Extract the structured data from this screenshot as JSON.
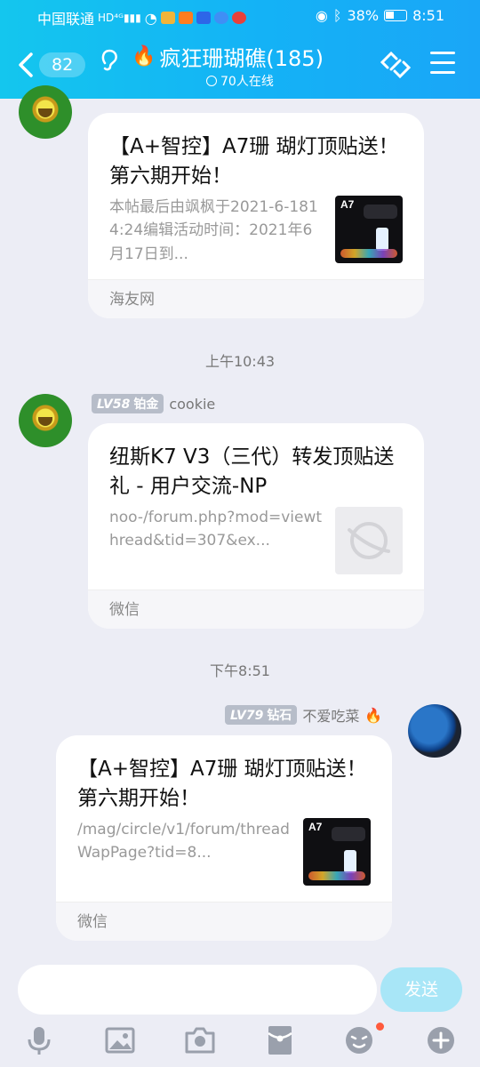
{
  "status_bar": {
    "carrier": "中国联通",
    "battery": "38%",
    "time": "8:51"
  },
  "header": {
    "unread_count": "82",
    "group_name": "疯狂珊瑚礁(185)",
    "online": "70人在线"
  },
  "messages": [
    {
      "card_title": "【A+智控】A7珊 瑚灯顶贴送！ 第六期开始！",
      "card_desc": "本帖最后由飒枫于2021-6-1814:24编辑活动时间：2021年6月17日到...",
      "card_source": "海友网",
      "thumb": "product-a7"
    },
    {
      "time": "上午10:43"
    },
    {
      "level": "LV58",
      "rank": "铂金",
      "sender": "cookie",
      "card_title": "纽斯K7 V3（三代）转发顶贴送礼 - 用户交流-NP",
      "card_desc": "noo-/forum.php?mod=viewthread&tid=307&ex...",
      "card_source": "微信",
      "thumb": "placeholder-planet"
    },
    {
      "time": "下午8:51"
    },
    {
      "level": "LV79",
      "rank": "钻石",
      "sender": "不爱吃菜",
      "card_title": "【A+智控】A7珊 瑚灯顶贴送！ 第六期开始！",
      "card_desc": "/mag/circle/v1/forum/threadWapPage?tid=8...",
      "card_source": "微信",
      "thumb": "product-a7"
    }
  ],
  "thumb_label": "A7",
  "composer": {
    "placeholder": "",
    "send_label": "发送"
  },
  "colors": {
    "header_start": "#14c6ee",
    "header_end": "#1aa6f7",
    "send_button": "#a8e6f7"
  }
}
